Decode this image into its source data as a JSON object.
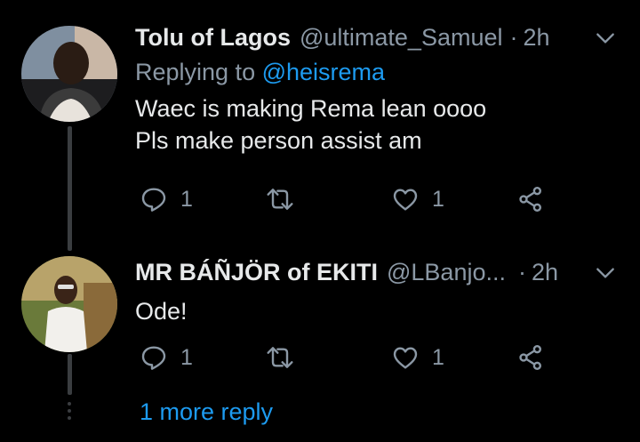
{
  "tweets": [
    {
      "display_name": "Tolu of Lagos",
      "handle": "@ultimate_Samuel",
      "time": "2h",
      "replying_prefix": "Replying to ",
      "replying_to": "@heisrema",
      "lines": [
        "Waec is making Rema lean oooo",
        "Pls make person assist am"
      ],
      "reply_count": "1",
      "retweet_count": "",
      "like_count": "1"
    },
    {
      "display_name": "MR BÁÑJÖR of EKITI",
      "handle": "@LBanjo...",
      "time": "2h",
      "lines": [
        "Ode!"
      ],
      "reply_count": "1",
      "retweet_count": "",
      "like_count": "1"
    }
  ],
  "more_replies": "1 more reply",
  "colors": {
    "background": "#000000",
    "text": "#e7e9ea",
    "muted": "#8b98a5",
    "accent": "#1d9bf0"
  },
  "icons": [
    "reply-icon",
    "retweet-icon",
    "like-icon",
    "share-icon",
    "chevron-down-icon"
  ]
}
